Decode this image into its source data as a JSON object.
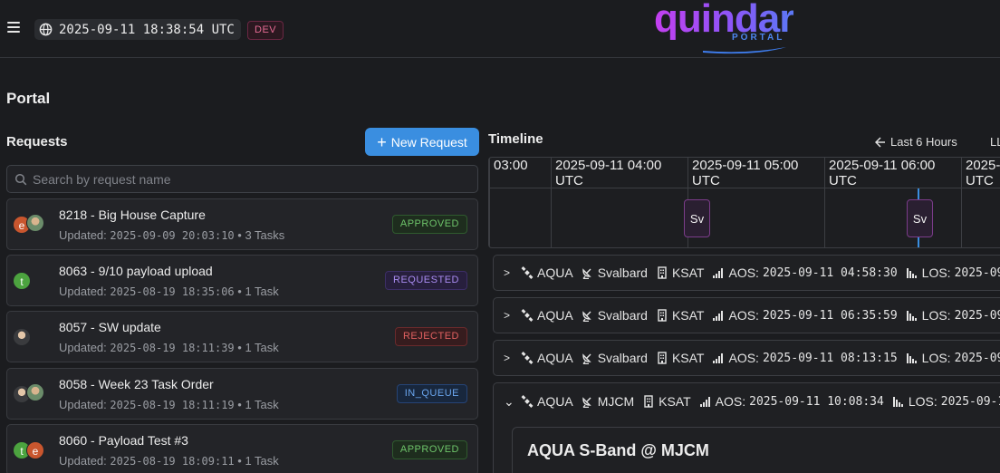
{
  "header": {
    "clock": "2025-09-11 18:38:54 UTC",
    "env": "DEV",
    "logo_main": "quindar",
    "logo_sub": "PORTAL"
  },
  "page": {
    "title": "Portal"
  },
  "requests": {
    "title": "Requests",
    "new_button": "New Request",
    "search_placeholder": "Search by request name",
    "items": [
      {
        "title": "8218 - Big House Capture",
        "updated_label": "Updated:",
        "updated": "2025-09-09 20:03:10",
        "tasks": "3 Tasks",
        "status": "APPROVED",
        "avatars": [
          "e",
          "photo"
        ]
      },
      {
        "title": "8063 - 9/10 payload upload",
        "updated_label": "Updated:",
        "updated": "2025-08-19 18:35:06",
        "tasks": "1 Task",
        "status": "REQUESTED",
        "avatars": [
          "t"
        ]
      },
      {
        "title": "8057 - SW update",
        "updated_label": "Updated:",
        "updated": "2025-08-19 18:11:39",
        "tasks": "1 Task",
        "status": "REJECTED",
        "avatars": [
          "photo"
        ]
      },
      {
        "title": "8058 - Week 23 Task Order",
        "updated_label": "Updated:",
        "updated": "2025-08-19 18:11:19",
        "tasks": "1 Task",
        "status": "IN_QUEUE",
        "avatars": [
          "photo",
          "photo"
        ]
      },
      {
        "title": "8060 - Payload Test #3",
        "updated_label": "Updated:",
        "updated": "2025-08-19 18:09:11",
        "tasks": "1 Task",
        "status": "APPROVED",
        "avatars": [
          "t",
          "e"
        ]
      }
    ]
  },
  "timeline": {
    "title": "Timeline",
    "range_label": "Last 6 Hours",
    "range_label_2": "LL",
    "ticks": [
      "03:00",
      "2025-09-11 04:00\nUTC",
      "2025-09-11 05:00\nUTC",
      "2025-09-11 06:00\nUTC",
      "2025-\nUTC"
    ],
    "markers": [
      "Sv",
      "Sv"
    ],
    "passes": [
      {
        "satellite": "AQUA",
        "site": "Svalbard",
        "provider": "KSAT",
        "aos_label": "AOS:",
        "aos": "2025-09-11 04:58:30",
        "los_label": "LOS:",
        "los": "2025-09",
        "expanded": false
      },
      {
        "satellite": "AQUA",
        "site": "Svalbard",
        "provider": "KSAT",
        "aos_label": "AOS:",
        "aos": "2025-09-11 06:35:59",
        "los_label": "LOS:",
        "los": "2025-09",
        "expanded": false
      },
      {
        "satellite": "AQUA",
        "site": "Svalbard",
        "provider": "KSAT",
        "aos_label": "AOS:",
        "aos": "2025-09-11 08:13:15",
        "los_label": "LOS:",
        "los": "2025-09",
        "expanded": false
      },
      {
        "satellite": "AQUA",
        "site": "MJCM",
        "provider": "KSAT",
        "aos_label": "AOS:",
        "aos": "2025-09-11 10:08:34",
        "los_label": "LOS:",
        "los": "2025-09-1",
        "expanded": true,
        "detail_title": "AQUA S-Band @ MJCM"
      }
    ]
  },
  "colors": {
    "accent": "#3a8ee0",
    "background": "#1b1c1f",
    "marker_border": "#7b3c8a"
  }
}
